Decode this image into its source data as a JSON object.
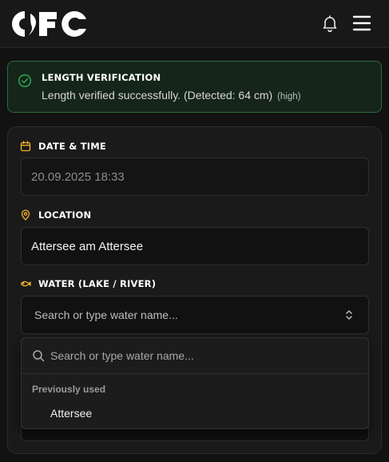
{
  "header": {
    "logo_text": "CFC",
    "icons": {
      "notifications": "bell-icon",
      "menu": "hamburger-menu-icon"
    }
  },
  "verification": {
    "title": "LENGTH VERIFICATION",
    "message": "Length verified successfully. (Detected: 64 cm)",
    "confidence": "(high)",
    "icon": "check-circle-icon",
    "status_color": "#2e6b3e"
  },
  "form": {
    "date_time": {
      "label": "DATE & TIME",
      "value": "20.09.2025 18:33",
      "icon": "calendar-icon"
    },
    "location": {
      "label": "LOCATION",
      "value": "Attersee am Attersee",
      "icon": "map-pin-icon"
    },
    "water": {
      "label": "WATER (LAKE / RIVER)",
      "placeholder": "Search or type water name...",
      "icon": "fish-icon"
    }
  },
  "dropdown": {
    "search_placeholder": "Search or type water name...",
    "group_label": "Previously used",
    "items": [
      "Attersee"
    ]
  },
  "colors": {
    "accent": "#f0b429",
    "success": "#2fa14f",
    "background": "#121212"
  }
}
